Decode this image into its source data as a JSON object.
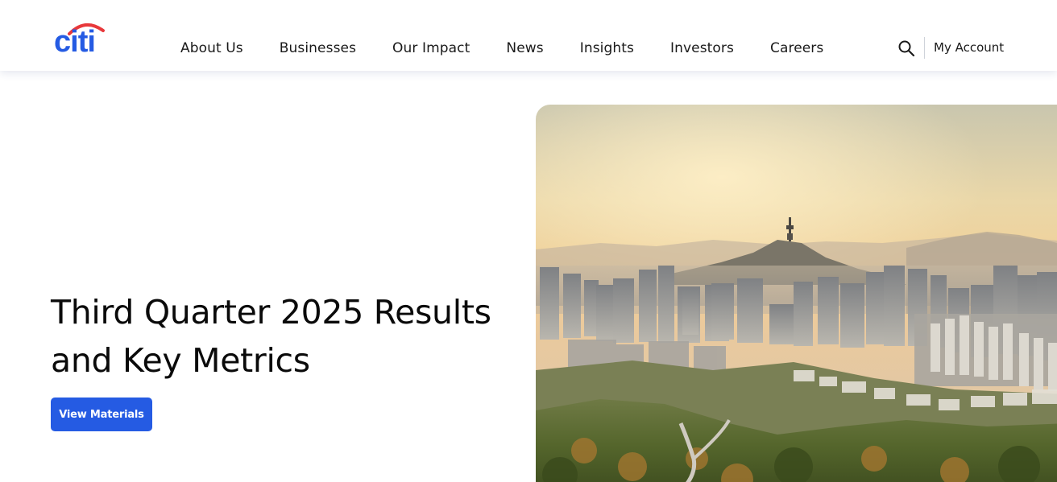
{
  "brand": {
    "logo_text": "citi",
    "logo_color": "#255be3",
    "arc_color": "#e8383b"
  },
  "nav": {
    "items": [
      {
        "label": "About Us",
        "name": "nav-about-us"
      },
      {
        "label": "Businesses",
        "name": "nav-businesses"
      },
      {
        "label": "Our Impact",
        "name": "nav-our-impact"
      },
      {
        "label": "News",
        "name": "nav-news"
      },
      {
        "label": "Insights",
        "name": "nav-insights"
      },
      {
        "label": "Investors",
        "name": "nav-investors"
      },
      {
        "label": "Careers",
        "name": "nav-careers"
      }
    ],
    "search_icon": "search-icon",
    "account_label": "My Account"
  },
  "hero": {
    "title_line1": "Third Quarter 2025 Results",
    "title_line2": "and Key Metrics",
    "cta_label": "View Materials",
    "cta_color": "#255be3",
    "image_subject": "city-skyline-photo"
  }
}
